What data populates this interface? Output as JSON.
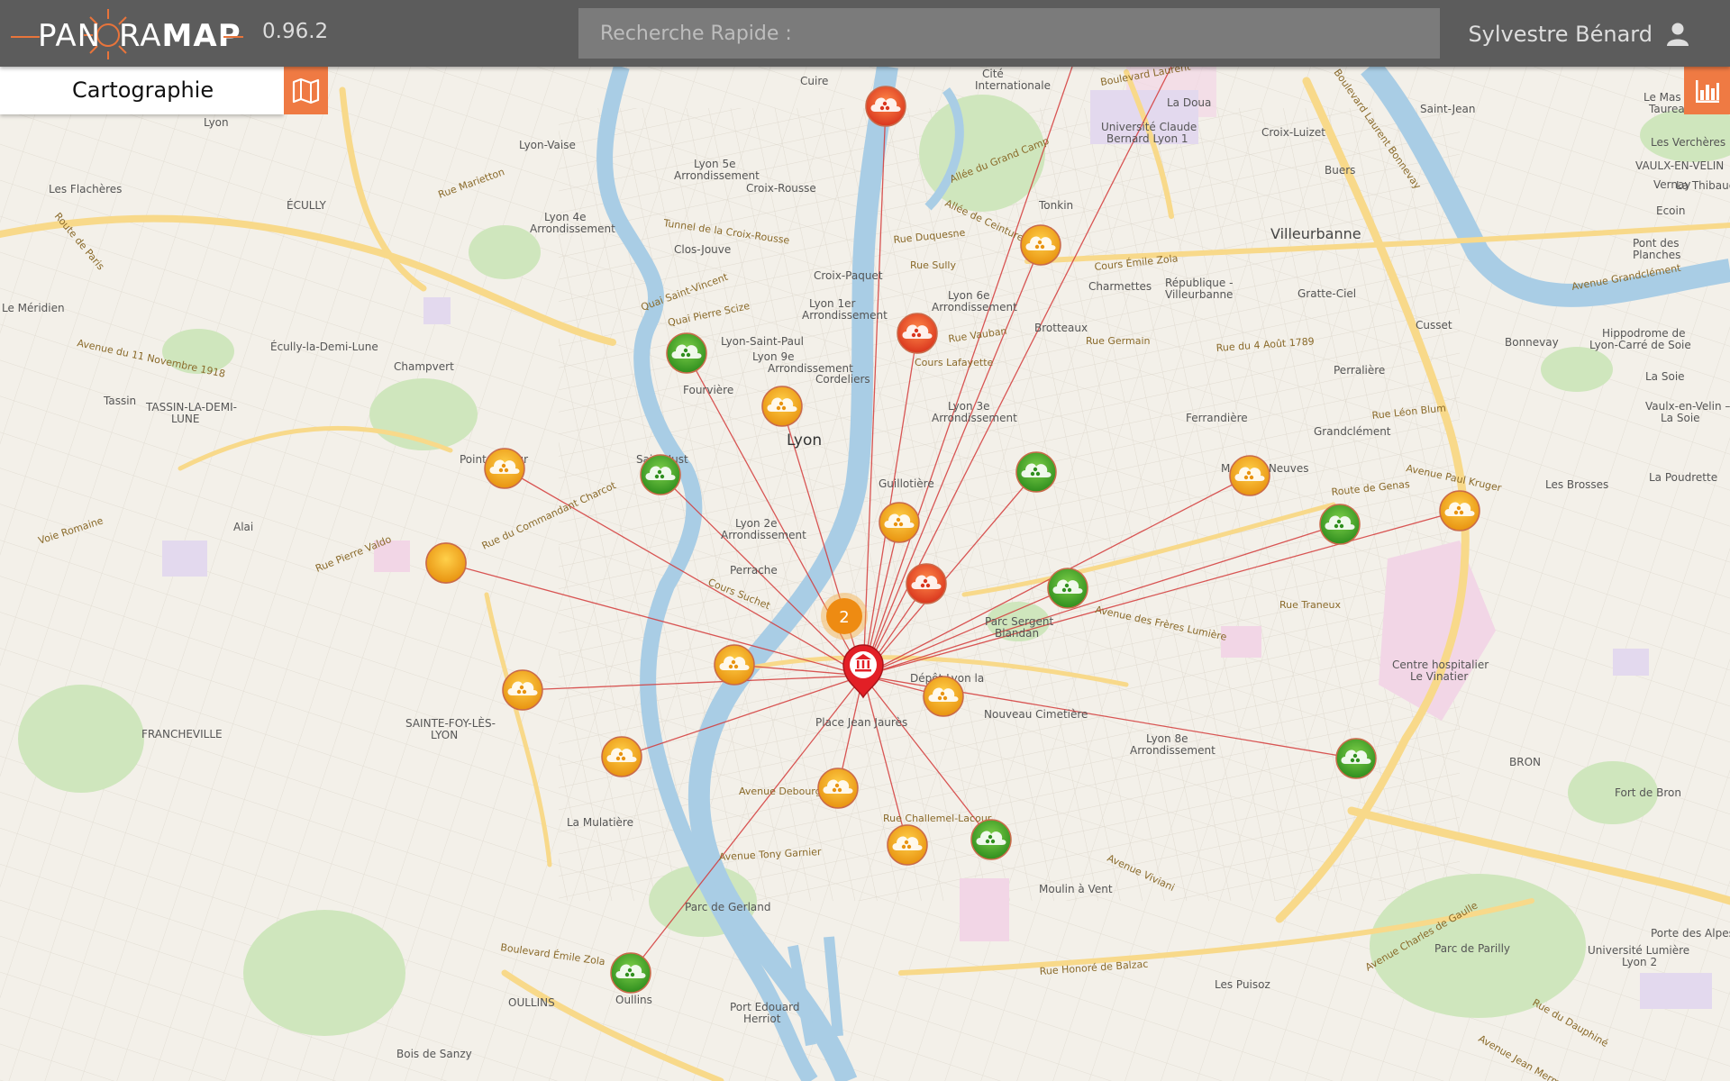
{
  "header": {
    "logo_left": "PAN",
    "logo_mid": "R",
    "logo_right": "A",
    "logo_bold": "MAP",
    "version": "0.96.2",
    "search_placeholder": "Recherche Rapide :",
    "user_name": "Sylvestre Bénard"
  },
  "panel": {
    "title": "Cartographie",
    "map_icon": "map-icon",
    "stats_icon": "bar-chart-icon"
  },
  "map": {
    "hub_icon": "museum-pin-icon",
    "cluster_count": "2",
    "colors": {
      "orange": "#f2a31b",
      "green": "#43a82a",
      "red": "#e8452b",
      "line": "#d43a3a"
    },
    "places": {
      "cuire": "Cuire",
      "cite": "Cité",
      "internationale": "Internationale",
      "la_doua": "La Doua",
      "universite": "Université Claude",
      "universite2": "Bernard Lyon 1",
      "villeurbanne": "Villeurbanne",
      "lyon": "Lyon",
      "lyon_vaise": "Lyon-Vaise",
      "ecully": "ÉCULLY",
      "ecully_station": "Écully-la-Demi-Lune",
      "tassin": "TASSIN-LA-DEMI-",
      "tassin2": "LUNE",
      "francheville": "FRANCHEVILLE",
      "sainte_foy": "SAINTE-FOY-LÈS-",
      "sainte_foy2": "LYON",
      "oullins": "OULLINS",
      "oullins_station": "Oullins",
      "la_mulatiere": "La Mulatière",
      "bron": "BRON",
      "vaulx": "VAULX-EN-VELIN",
      "croix_paquet": "Croix-Paquet",
      "cordeliers": "Cordeliers",
      "fourviere": "Fourvière",
      "guillotiere": "Guillotière",
      "perrache": "Perrache",
      "brotteaux": "Brotteaux",
      "parc_gerland": "Parc de Gerland",
      "port_edouard": "Port Edouard",
      "port_edouard2": "Herriot",
      "place_jean_jaures": "Place Jean Jaurès",
      "nouveau_cimetiere": "Nouveau Cimetière",
      "centre_hospitalier": "Centre hospitalier",
      "le_vinatier": "Le Vinatier",
      "hippodrome": "Hippodrome de",
      "hippodrome2": "Lyon-Carré de Soie",
      "parc_parilly": "Parc de Parilly",
      "fort_bron": "Fort de Bron",
      "universite_lumiere": "Université Lumière",
      "universite_lumiere2": "Lyon 2",
      "porte_alpes": "Porte des Alpes",
      "le_meridien": "Le Méridien",
      "les_flacheres": "Les Flachères",
      "champvert": "Champvert",
      "alai": "Alai",
      "bois_de_sanzy": "Bois de Sanzy",
      "parc_sergent": "Parc Sergent",
      "parc_sergent2": "Blandan",
      "moulin_vent": "Moulin à Vent",
      "les_puisoz": "Les Puisoz",
      "gratte_ciel": "Gratte-Ciel",
      "republique": "République -",
      "republique2": "Villeurbanne",
      "charmettes": "Charmettes",
      "tonkin": "Tonkin",
      "cusset": "Cusset",
      "bonnevay": "Bonnevay",
      "perralliere": "Perralière",
      "grandclement": "Grandclément",
      "ferrandiere": "Ferrandière",
      "maisons_neuves": "Maisons-Neuves",
      "buers": "Buers",
      "croix_luizet": "Croix-Luizet",
      "les_brosses": "Les Brosses",
      "la_poudrette": "La Poudrette",
      "vaulx_la_soie": "Vaulx-en-Velin –",
      "vaulx_la_soie2": "La Soie",
      "la_soie": "La Soie",
      "pont_planches": "Pont des",
      "pont_planches2": "Planches",
      "vernay": "Vernay",
      "ecoin": "Ecoin",
      "saint_jean": "Saint-Jean",
      "le_mas": "Le Mas du",
      "le_mas2": "Taureau",
      "les_verchere": "Les Verchères",
      "la_thibaude": "La Thibaude",
      "lyon_5e": "Lyon 5e",
      "lyon_5e2": "Arrondissement",
      "lyon_2e": "Lyon 2e",
      "lyon_2e2": "Arrondissement",
      "lyon_1er": "Lyon 1er",
      "lyon_1er2": "Arrondissement",
      "lyon_4e": "Lyon 4e",
      "lyon_4e2": "Arrondissement",
      "lyon_6e": "Lyon 6e",
      "lyon_6e2": "Arrondissement",
      "lyon_3e": "Lyon 3e",
      "lyon_3e2": "Arrondissement",
      "lyon_8e": "Lyon 8e",
      "lyon_8e2": "Arrondissement",
      "lyon_9e": "Lyon 9e",
      "lyon_9e2": "Arrondissement",
      "lyon_saint_paul": "Lyon-Saint-Paul",
      "depot": "Dépôt Lyon la",
      "clos_jouve": "Clos-Jouve",
      "croix_rousse": "Croix-Rousse",
      "point_du_jour": "Point du Jour",
      "saint_just": "Saint-Just",
      "lyon_top": "Lyon",
      "tassin_station": "Tassin"
    },
    "roads": {
      "boulevard_laurent": "Boulevard Laurent",
      "boulevard_laurent_bonnevay": "Boulevard Laurent Bonnevay",
      "avenue_11_novembre": "Avenue du 11 Novembre 1918",
      "tunnel_croix_rousse": "Tunnel de la Croix-Rousse",
      "rue_duquesne": "Rue Duquesne",
      "rue_sully": "Rue Sully",
      "cours_emile_zola": "Cours Émile Zola",
      "rue_germain": "Rue Germain",
      "rue_4_aout": "Rue du 4 Août 1789",
      "cours_lafayette": "Cours Lafayette",
      "rue_vauban": "Rue Vauban",
      "rue_leon_blum": "Rue Léon Blum",
      "route_genas": "Route de Genas",
      "avenue_paul_kruger": "Avenue Paul Kruger",
      "avenue_freres_lumiere": "Avenue des Frères Lumière",
      "rue_traneux": "Rue Traneux",
      "avenue_debourg": "Avenue Debourg",
      "rue_challemel": "Rue Challemel-Lacour",
      "avenue_tony_garnier": "Avenue Tony Garnier",
      "boulevard_emile_zola": "Boulevard Émile Zola",
      "rue_honore_balzac": "Rue Honoré de Balzac",
      "avenue_viviani": "Avenue Viviani",
      "rue_commandant_charcot": "Rue du Commandant Charcot",
      "voie_romaine": "Voie Romaine",
      "rue_pierre_valdo": "Rue Pierre Valdo",
      "avenue_charles_gaulle": "Avenue Charles de Gaulle",
      "avenue_grandclement": "Avenue Grandclément",
      "route_paris": "Route de Paris",
      "quai_saint_vincent": "Quai Saint-Vincent",
      "quai_pierre_scize": "Quai Pierre Scize",
      "allee_grand_camp": "Allée du Grand Camp",
      "allee_ceinture": "Allée de Ceinture",
      "rue_marietton": "Rue Marietton",
      "cours_suchet": "Cours Suchet",
      "rue_dauphine": "Rue du Dauphiné",
      "avenue_jean_mermoz": "Avenue Jean Mermoz"
    }
  }
}
